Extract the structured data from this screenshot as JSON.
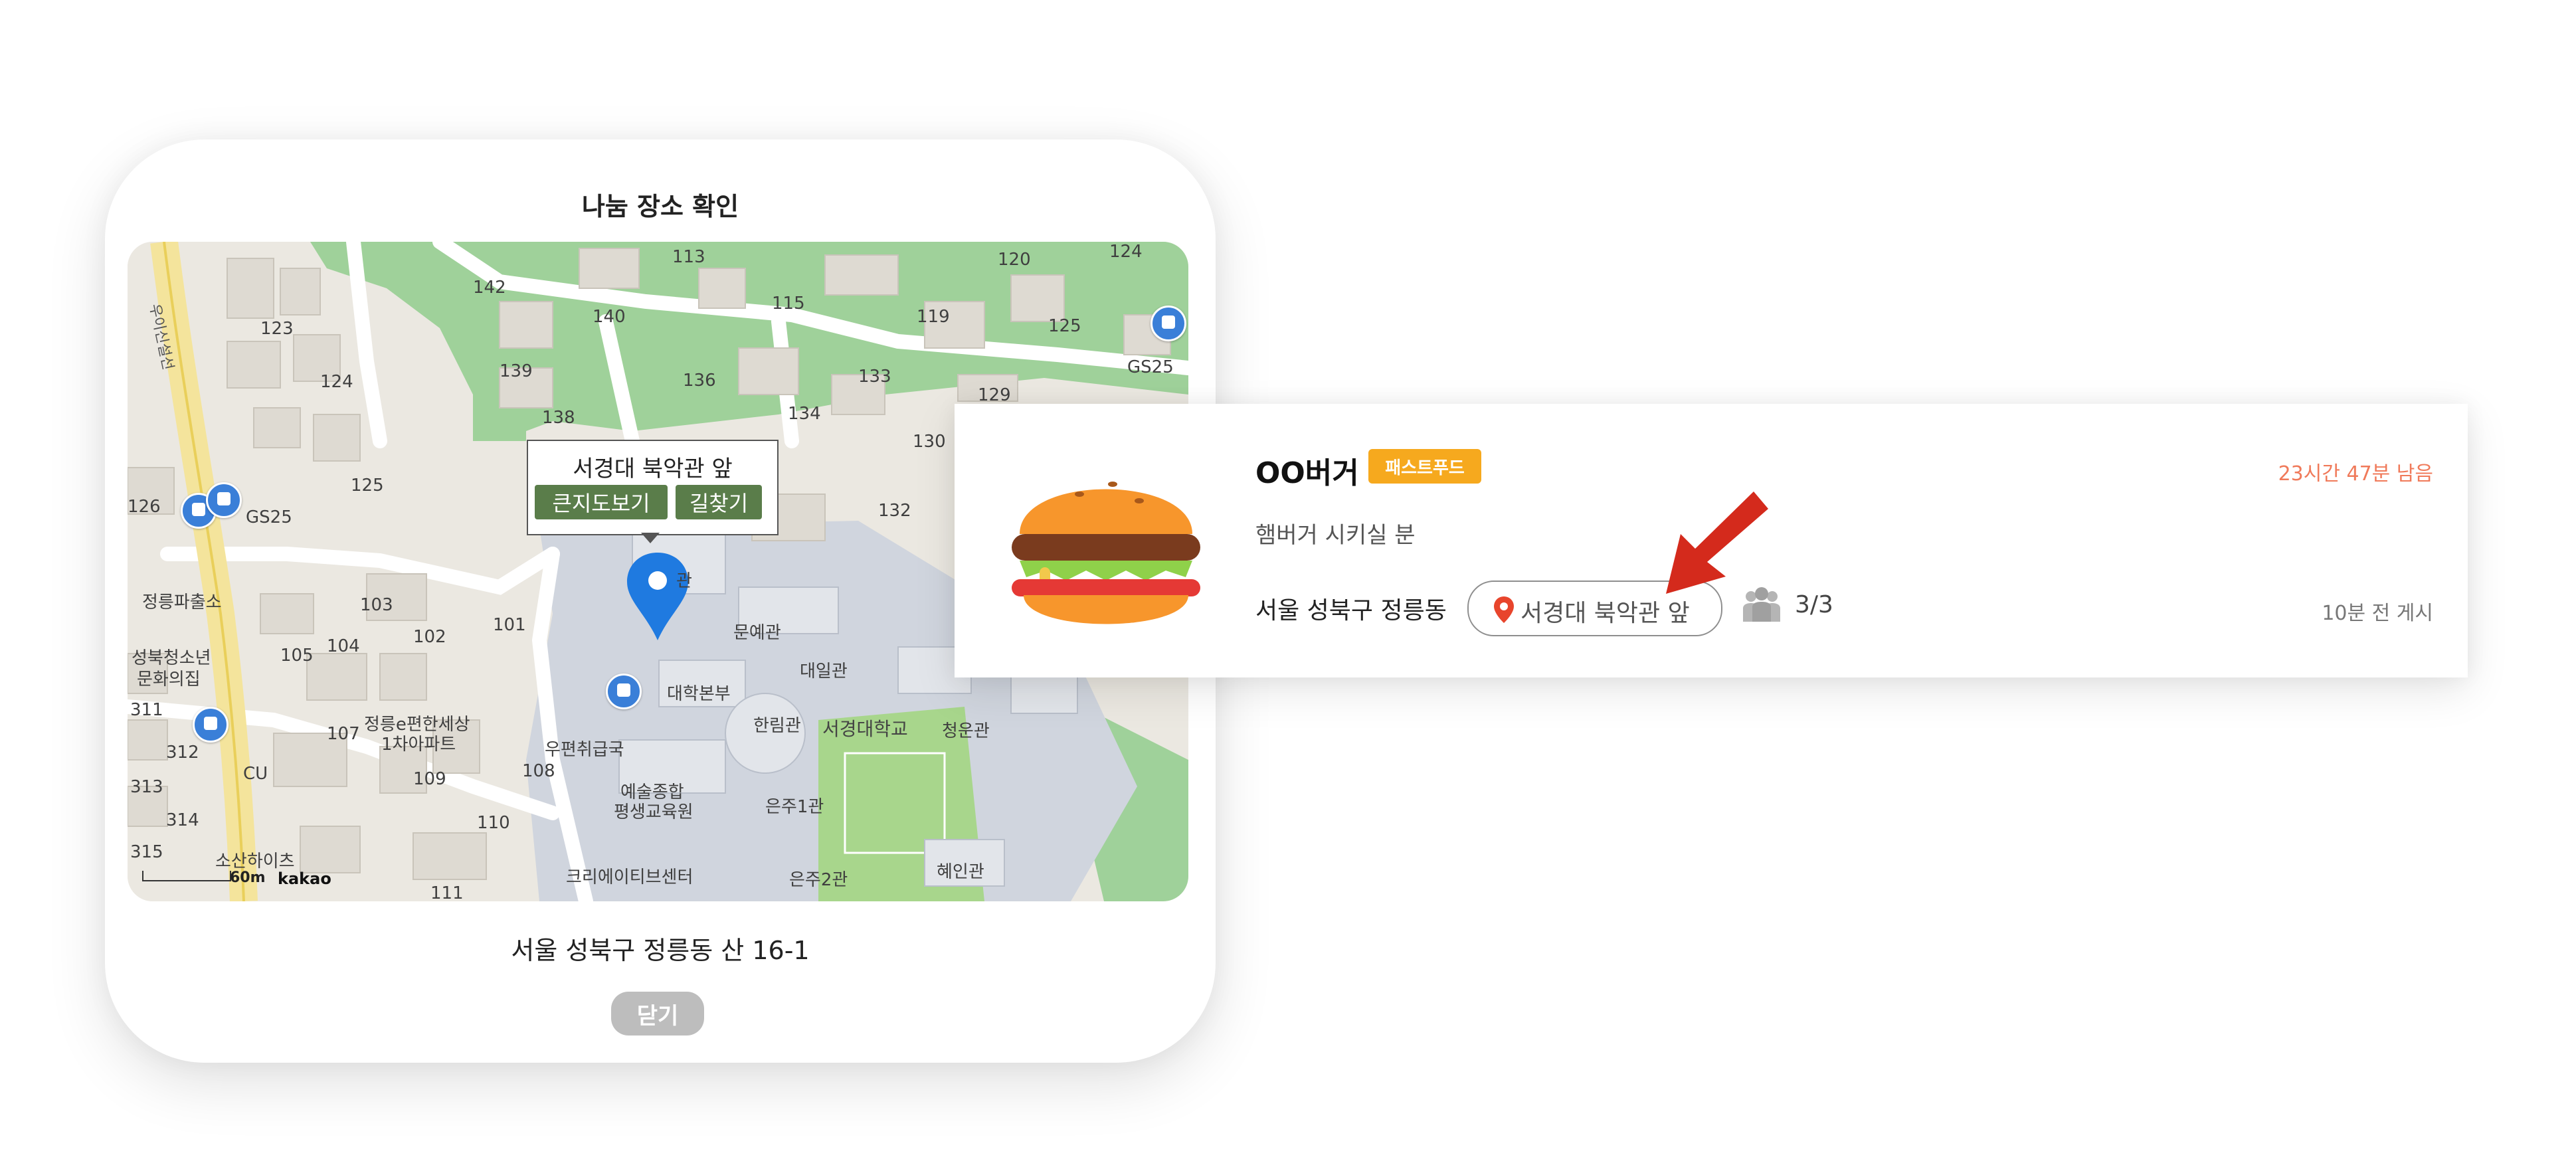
{
  "modal": {
    "title": "나눔 장소 확인",
    "address": "서울 성북구 정릉동 산 16-1",
    "close_label": "닫기",
    "map": {
      "info_window": {
        "title": "서경대 북악관 앞",
        "big_map_label": "큰지도보기",
        "directions_label": "길찾기"
      },
      "labels": {
        "n113": "113",
        "n120": "120",
        "n124": "124",
        "n142": "142",
        "n140": "140",
        "n115": "115",
        "n119": "119",
        "n125a": "125",
        "n123": "123",
        "n124b": "124",
        "n139": "139",
        "n136": "136",
        "n133": "133",
        "n129": "129",
        "n138": "138",
        "n134": "134",
        "n130": "130",
        "n126": "126",
        "n125b": "125",
        "n132": "132",
        "n103": "103",
        "n102": "102",
        "n101": "101",
        "n105": "105",
        "n104": "104",
        "n107": "107",
        "n109": "109",
        "n108": "108",
        "n110": "110",
        "n111": "111",
        "n311": "311",
        "n312": "312",
        "n313": "313",
        "n314": "314",
        "n315": "315",
        "gs25_left": "GS25",
        "gs25_right": "GS25",
        "cu": "CU",
        "police": "정릉파출소",
        "youth_center_1": "성북청소년",
        "youth_center_2": "문화의집",
        "apartment_1": "정릉e편한세상",
        "apartment_2": "1차아파트",
        "post_office": "우편취급국",
        "arts_1": "예술종합",
        "arts_2": "평생교육원",
        "creative_center": "크리에이티브센터",
        "hill_heights": "소산하이츠",
        "munye": "문예관",
        "daeil": "대일관",
        "hq": "대학본부",
        "hallim": "한림관",
        "univ": "서경대학교",
        "cheongun": "청운관",
        "eunju1": "은주1관",
        "eunju2": "은주2관",
        "hyein": "혜인관",
        "bugak": "관",
        "road": "우이신설선"
      },
      "scale_label": "60m",
      "brand": "kakao"
    }
  },
  "card": {
    "store_name": "OO버거",
    "category_badge": "패스트푸드",
    "time_remaining": "23시간 47분 남음",
    "description": "햄버거 시키실 분",
    "region": "서울 성북구 정릉동",
    "place": "서경대 북악관 앞",
    "participants": "3/3",
    "posted": "10분 전 게시",
    "colors": {
      "badge": "#f6a91e",
      "remaining": "#f07a5a",
      "arrow": "#d42a1c"
    }
  }
}
